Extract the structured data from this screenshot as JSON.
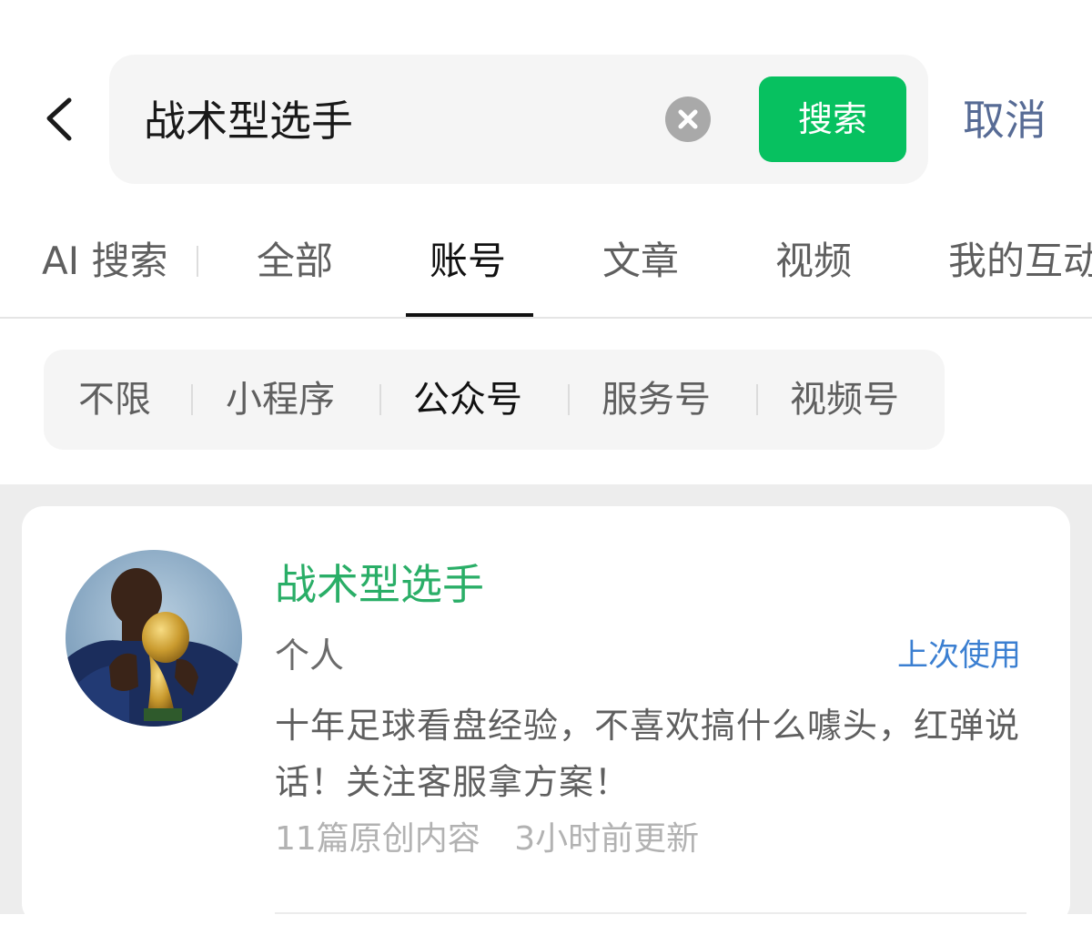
{
  "search": {
    "query": "战术型选手",
    "button_label": "搜索",
    "cancel_label": "取消"
  },
  "tabs": [
    {
      "label": "AI 搜索",
      "active": false
    },
    {
      "label": "全部",
      "active": false
    },
    {
      "label": "账号",
      "active": true
    },
    {
      "label": "文章",
      "active": false
    },
    {
      "label": "视频",
      "active": false
    },
    {
      "label": "我的互动",
      "active": false
    }
  ],
  "filters": [
    {
      "label": "不限",
      "active": false
    },
    {
      "label": "小程序",
      "active": false
    },
    {
      "label": "公众号",
      "active": true
    },
    {
      "label": "服务号",
      "active": false
    },
    {
      "label": "视频号",
      "active": false
    }
  ],
  "result": {
    "name": "战术型选手",
    "type": "个人",
    "last_used": "上次使用",
    "description": "十年足球看盘经验，不喜欢搞什么噱头，红弹说话！关注客服拿方案！",
    "article_count": "11篇原创内容",
    "updated": "3小时前更新"
  },
  "colors": {
    "accent_green": "#07c160",
    "name_green": "#2aae67",
    "cancel_blue": "#576b95",
    "link_blue": "#3b7fd1"
  },
  "icons": {
    "back": "chevron-left-icon",
    "clear": "clear-icon"
  }
}
